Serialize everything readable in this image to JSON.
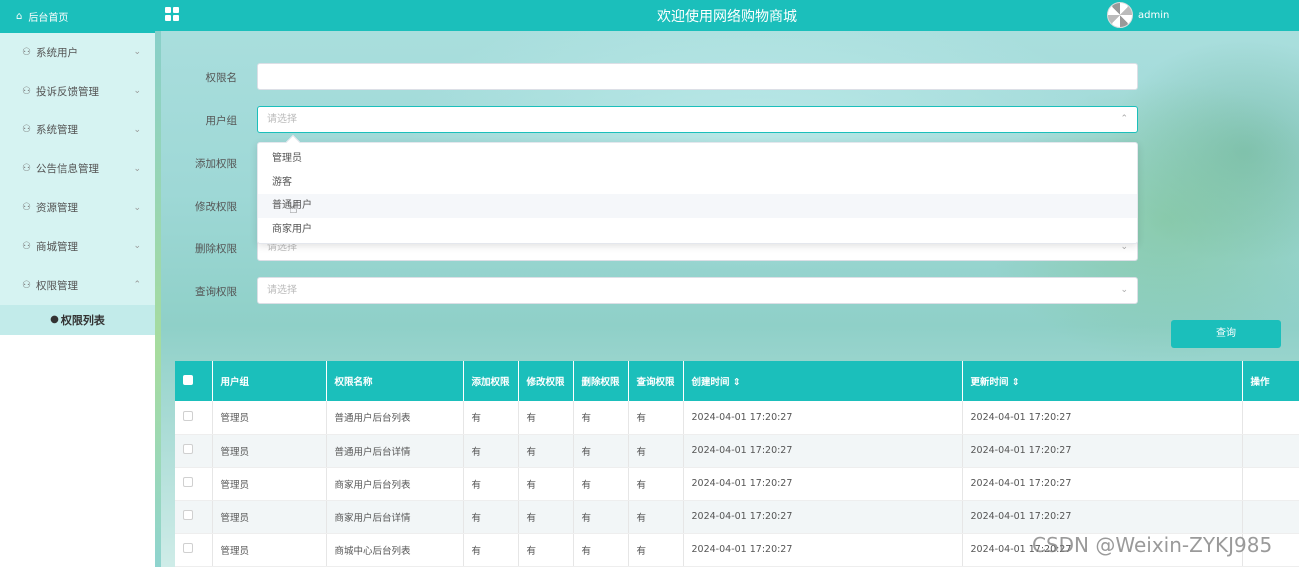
{
  "sidebar": {
    "brand": "后台首页",
    "items": [
      {
        "label": "系统用户",
        "chevron": "⌄"
      },
      {
        "label": "投诉反馈管理",
        "chevron": "⌄"
      },
      {
        "label": "系统管理",
        "chevron": "⌄"
      },
      {
        "label": "公告信息管理",
        "chevron": "⌄"
      },
      {
        "label": "资源管理",
        "chevron": "⌄"
      },
      {
        "label": "商城管理",
        "chevron": "⌄"
      },
      {
        "label": "权限管理",
        "chevron": "⌃"
      }
    ],
    "subitem": "权限列表"
  },
  "header": {
    "title": "欢迎使用网络购物商城",
    "username": "admin"
  },
  "form": {
    "name_label": "权限名",
    "name_value": "",
    "group_label": "用户组",
    "group_placeholder": "请选择",
    "add_label": "添加权限",
    "edit_label": "修改权限",
    "delete_label": "删除权限",
    "delete_placeholder": "请选择",
    "query_label": "查询权限",
    "query_placeholder": "请选择"
  },
  "dropdown": {
    "options": [
      "管理员",
      "游客",
      "普通用户",
      "商家用户"
    ],
    "hovered_index": 2
  },
  "search_button": "查询",
  "table": {
    "headers": [
      "用户组",
      "权限名称",
      "添加权限",
      "修改权限",
      "删除权限",
      "查询权限",
      "创建时间 ⇕",
      "更新时间 ⇕",
      "操作"
    ],
    "rows": [
      [
        "管理员",
        "普通用户后台列表",
        "有",
        "有",
        "有",
        "有",
        "2024-04-01 17:20:27",
        "2024-04-01 17:20:27",
        ""
      ],
      [
        "管理员",
        "普通用户后台详情",
        "有",
        "有",
        "有",
        "有",
        "2024-04-01 17:20:27",
        "2024-04-01 17:20:27",
        ""
      ],
      [
        "管理员",
        "商家用户后台列表",
        "有",
        "有",
        "有",
        "有",
        "2024-04-01 17:20:27",
        "2024-04-01 17:20:27",
        ""
      ],
      [
        "管理员",
        "商家用户后台详情",
        "有",
        "有",
        "有",
        "有",
        "2024-04-01 17:20:27",
        "2024-04-01 17:20:27",
        ""
      ],
      [
        "管理员",
        "商城中心后台列表",
        "有",
        "有",
        "有",
        "有",
        "2024-04-01 17:20:27",
        "2024-04-01 17:20:27",
        ""
      ]
    ]
  },
  "watermark": "CSDN @Weixin-ZYKJ985",
  "colors": {
    "accent": "#1bbfbb",
    "sidebar_bg": "#d6f3f2"
  }
}
